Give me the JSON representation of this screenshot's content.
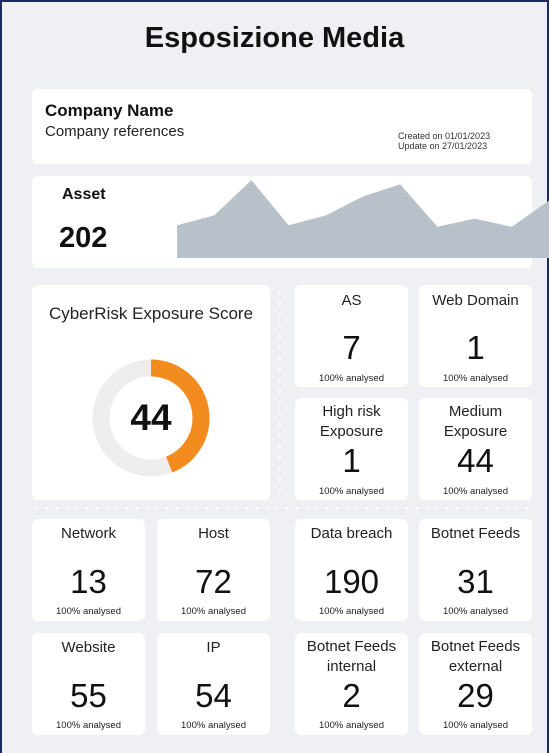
{
  "page": {
    "title": "Esposizione Media"
  },
  "company": {
    "name": "Company Name",
    "references": "Company references",
    "created": "Created on 01/01/2023",
    "updated": "Update on 27/01/2023"
  },
  "asset": {
    "label": "Asset",
    "value": "202",
    "sparkline_values": [
      0.4,
      0.52,
      0.95,
      0.4,
      0.52,
      0.75,
      0.9,
      0.38,
      0.48,
      0.38,
      0.7
    ],
    "fill_color": "#b8c0ca"
  },
  "score": {
    "title": "CyberRisk Exposure Score",
    "value": "44",
    "fraction": 0.44,
    "accent_color": "#f28c1f",
    "track_color": "#eeeeee"
  },
  "tiles": {
    "as": {
      "label": "AS",
      "value": "7",
      "sub": "100% analysed"
    },
    "web_domain": {
      "label": "Web Domain",
      "value": "1",
      "sub": "100% analysed"
    },
    "high_risk": {
      "label": "High risk Exposure",
      "value": "1",
      "sub": "100% analysed"
    },
    "medium": {
      "label": "Medium Exposure",
      "value": "44",
      "sub": "100% analysed"
    },
    "network": {
      "label": "Network",
      "value": "13",
      "sub": "100% analysed"
    },
    "host": {
      "label": "Host",
      "value": "72",
      "sub": "100% analysed"
    },
    "data_breach": {
      "label": "Data breach",
      "value": "190",
      "sub": "100% analysed"
    },
    "botnet_feeds": {
      "label": "Botnet Feeds",
      "value": "31",
      "sub": "100% analysed"
    },
    "website": {
      "label": "Website",
      "value": "55",
      "sub": "100% analysed"
    },
    "ip": {
      "label": "IP",
      "value": "54",
      "sub": "100% analysed"
    },
    "botnet_internal": {
      "label": "Botnet Feeds internal",
      "value": "2",
      "sub": "100% analysed"
    },
    "botnet_external": {
      "label": "Botnet Feeds external",
      "value": "29",
      "sub": "100% analysed"
    }
  }
}
